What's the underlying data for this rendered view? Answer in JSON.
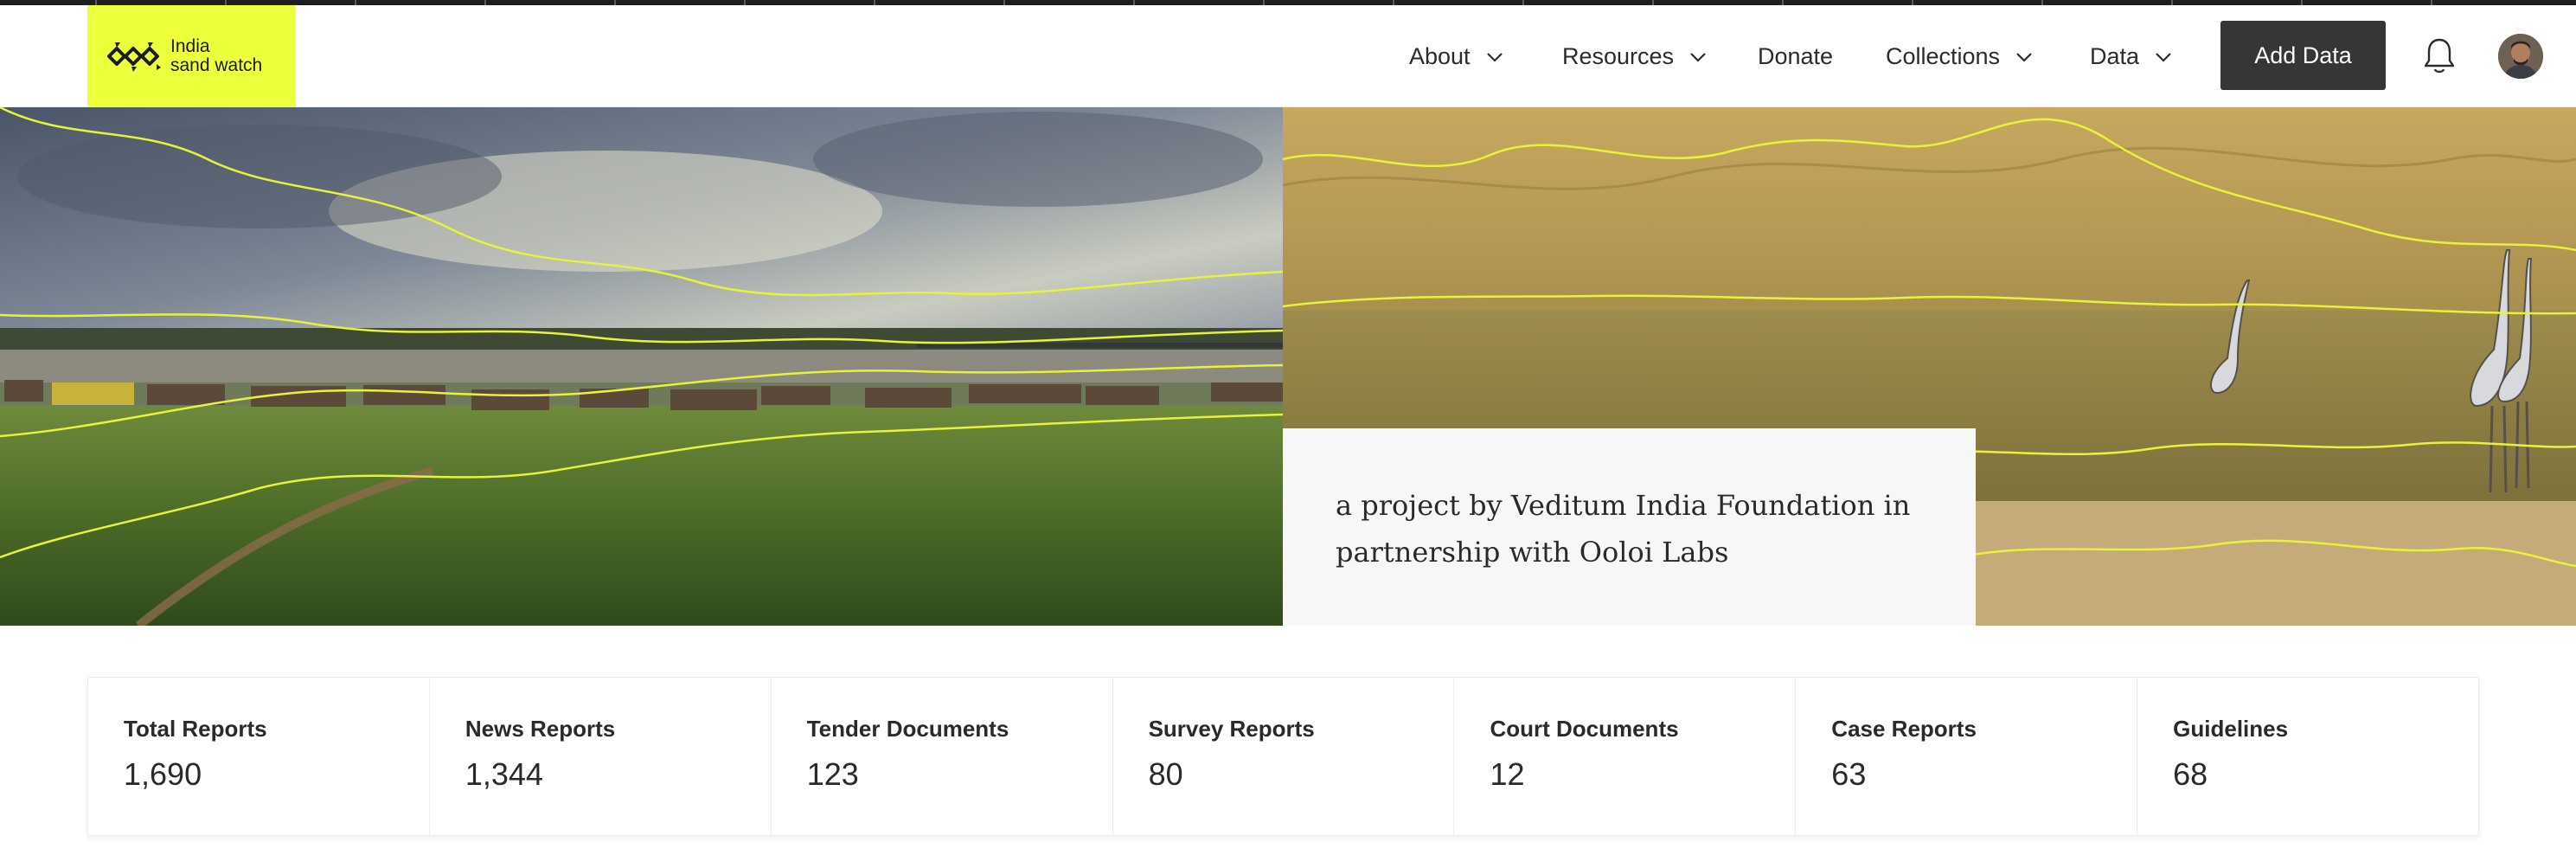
{
  "brand": {
    "line1": "India",
    "line2": "sand watch",
    "accent": "#eeff3c"
  },
  "nav": {
    "about": "About",
    "resources": "Resources",
    "donate": "Donate",
    "collections": "Collections",
    "data": "Data"
  },
  "actions": {
    "add_data": "Add Data"
  },
  "icons": {
    "bell": "bell-icon",
    "chevron": "chevron-down-icon",
    "avatar": "user-avatar"
  },
  "hero": {
    "caption": "a project by Veditum India Foundation in partnership with Ooloi Labs"
  },
  "stats": [
    {
      "label": "Total Reports",
      "value": "1,690"
    },
    {
      "label": "News Reports",
      "value": "1,344"
    },
    {
      "label": "Tender Documents",
      "value": "123"
    },
    {
      "label": "Survey Reports",
      "value": "80"
    },
    {
      "label": "Court Documents",
      "value": "12"
    },
    {
      "label": "Case Reports",
      "value": "63"
    },
    {
      "label": "Guidelines",
      "value": "68"
    }
  ],
  "colors": {
    "button_dark": "#363636",
    "highlight": "#e7f23a"
  }
}
